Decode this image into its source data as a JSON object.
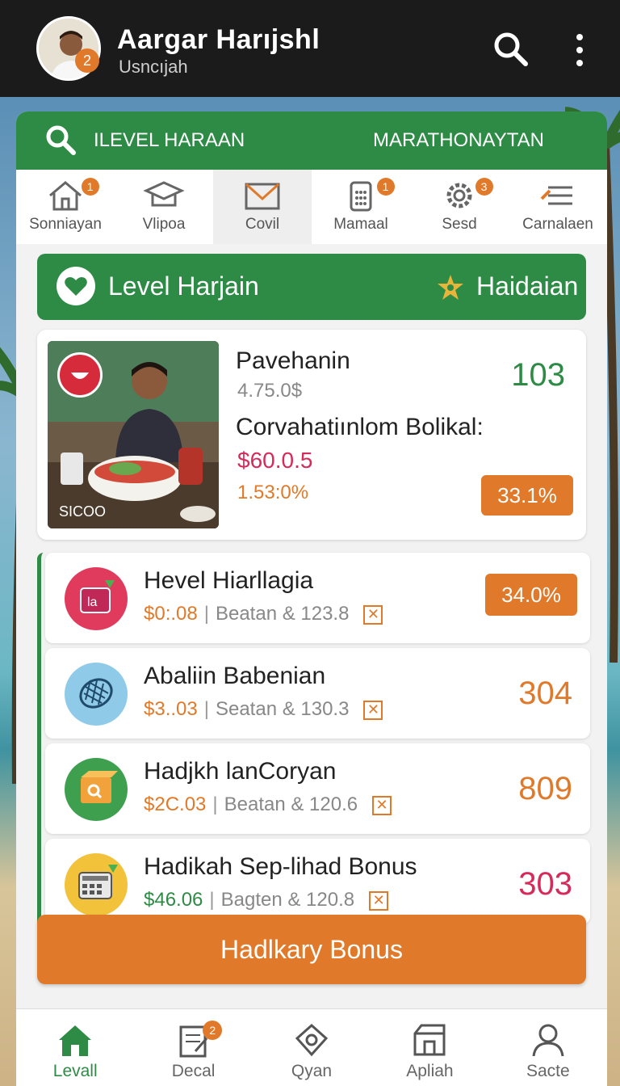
{
  "header": {
    "name": "Aargar Harıjshl",
    "subtitle": "Usncıjah",
    "avatar_badge": "2"
  },
  "search_strip": {
    "left_label": "ILEVEL HARAAN",
    "right_label": "MARATHONAYTAN"
  },
  "categories": [
    {
      "label": "Sonniayan",
      "badge": "1",
      "icon": "home-icon"
    },
    {
      "label": "Vlipoa",
      "badge": "",
      "icon": "graduation-cap-icon"
    },
    {
      "label": "Covil",
      "badge": "",
      "icon": "mail-icon"
    },
    {
      "label": "Mamaal",
      "badge": "1",
      "icon": "calculator-icon"
    },
    {
      "label": "Sesd",
      "badge": "3",
      "icon": "gear-icon"
    },
    {
      "label": "Carnalaen",
      "badge": "",
      "icon": "list-icon"
    }
  ],
  "level_banner": {
    "title": "Level Harjain",
    "right_label": "Haidaian"
  },
  "feature": {
    "photo_caption": "SICOO",
    "title": "Pavehanin",
    "subtitle": "4.75.0$",
    "number": "103",
    "line": "Corvahatiınlom Bolikal:",
    "price": "$60.0.5",
    "percent": "1.53:0%",
    "badge": "33.1%"
  },
  "rows": [
    {
      "title": "Hevel Hiarllagia",
      "price": "$0:.08",
      "meta": "Beatan & 123.8",
      "value": "34.0%",
      "value_type": "badge",
      "icon": "gift-bag-icon",
      "icon_bg": "#e03a5c",
      "value_color": "#e07a2a"
    },
    {
      "title": "Abaliin Babenian",
      "price": "$3..03",
      "meta": "Seatan & 130.3",
      "value": "304",
      "value_type": "text",
      "icon": "waffle-icon",
      "icon_bg": "#8fcbe8",
      "value_color": "#e07a2a"
    },
    {
      "title": "Hadjkh lanCoryan",
      "price": "$2C.03",
      "meta": "Beatan & 120.6",
      "value": "809",
      "value_type": "text",
      "icon": "box-icon",
      "icon_bg": "#3ea04f",
      "value_color": "#e07a2a"
    },
    {
      "title": "Hadikah Sep-lihad Bonus",
      "price": "$46.06",
      "meta": "Bagten & 120.8",
      "value": "303",
      "value_type": "text",
      "icon": "calculator-icon",
      "icon_bg": "#f2c23a",
      "value_color": "#d62b5a"
    }
  ],
  "bonus_button": "Hadlkary Bonus",
  "bottom_nav": [
    {
      "label": "Levall",
      "badge": "",
      "icon": "home-icon",
      "active": true
    },
    {
      "label": "Decal",
      "badge": "2",
      "icon": "document-icon",
      "active": false
    },
    {
      "label": "Qyan",
      "badge": "",
      "icon": "tag-icon",
      "active": false
    },
    {
      "label": "Apliah",
      "badge": "",
      "icon": "store-icon",
      "active": false
    },
    {
      "label": "Sacte",
      "badge": "",
      "icon": "person-icon",
      "active": false
    }
  ],
  "colors": {
    "primary_green": "#2e8b45",
    "accent_orange": "#e07a2a",
    "accent_pink": "#d62b5a"
  }
}
